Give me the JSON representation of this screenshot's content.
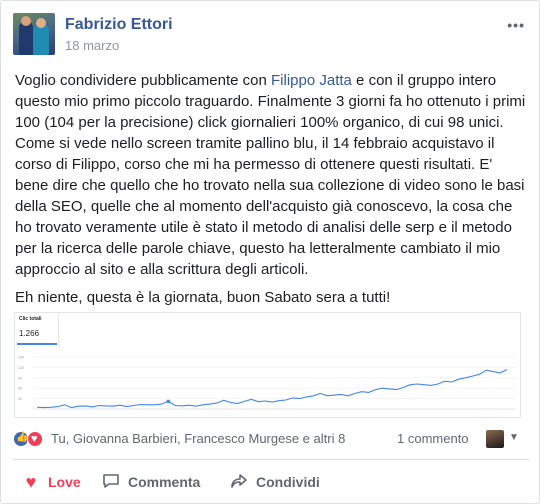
{
  "post": {
    "author": "Fabrizio Ettori",
    "date": "18 marzo",
    "menu_glyph": "•••",
    "text_p1_before": "Voglio condividere pubblicamente con ",
    "mention": "Filippo Jatta",
    "text_p1_after": " e con il gruppo intero questo mio primo piccolo traguardo. Finalmente 3 giorni fa ho ottenuto i primi 100 (104 per la precisione) click giornalieri 100% organico, di cui 98 unici. Come si vede nello screen tramite pallino blu, il 14 febbraio acquistavo il corso di Filippo, corso che mi ha permesso di ottenere questi risultati. E' bene dire che quello che ho trovato nella sua collezione di video sono le basi della SEO, quelle che al momento dell'acquisto già conoscevo, la cosa che ho trovato veramente utile è stato il metodo di analisi delle serp e il metodo per la ricerca delle parole chiave, questo ha letteralmente cambiato il mio approccio al sito e alla scrittura degli articoli.",
    "text_p2": "Eh niente, questa è la giornata, buon Sabato sera a tutti!"
  },
  "chart_data": {
    "type": "line",
    "title": "Clic totali",
    "total": "1.266",
    "ylim": [
      0,
      150
    ],
    "y_ticks": [
      "150",
      "120",
      "90",
      "60",
      "30"
    ],
    "marker_index": 19,
    "color": "#4285f4",
    "series": [
      {
        "values": [
          5,
          4,
          5,
          7,
          12,
          4,
          8,
          9,
          6,
          10,
          9,
          8,
          11,
          7,
          10,
          13,
          12,
          12,
          14,
          22,
          10,
          9,
          11,
          8,
          12,
          14,
          17,
          25,
          19,
          16,
          22,
          28,
          21,
          23,
          20,
          24,
          26,
          32,
          30,
          35,
          38,
          45,
          38,
          40,
          42,
          38,
          45,
          50,
          48,
          56,
          60,
          58,
          56,
          62,
          70,
          72,
          70,
          68,
          72,
          80,
          78,
          86,
          90,
          95,
          100,
          112,
          108,
          104,
          114
        ]
      }
    ]
  },
  "reactions": {
    "names": "Tu, Giovanna Barbieri, Francesco Murgese e altri 8",
    "comments": "1 commento",
    "like_color": "#4267b2",
    "love_color": "#f33e58"
  },
  "actions": {
    "love": "Love",
    "comment": "Commenta",
    "share": "Condividi"
  }
}
